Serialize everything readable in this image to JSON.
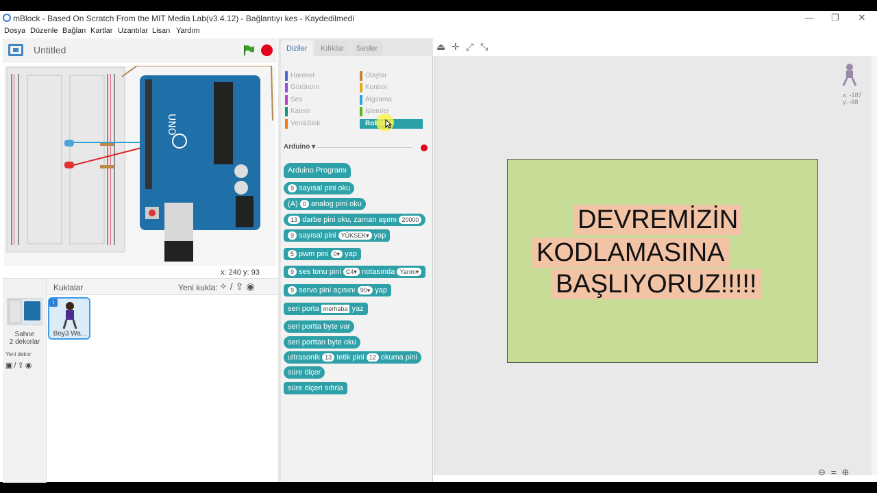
{
  "window": {
    "title": "mBlock - Based On Scratch From the MIT Media Lab(v3.4.12) - Bağlantıyı kes - Kaydedilmedi",
    "min": "—",
    "max": "❐",
    "close": "✕"
  },
  "menu": [
    "Dosya",
    "Düzenle",
    "Bağlan",
    "Kartlar",
    "Uzantılar",
    "Lisan",
    "Yardım"
  ],
  "stage": {
    "project_title": "Untitled",
    "coords": "x: 240  y: 93",
    "breadboard_cols_top": "a b c d e   f g h i j",
    "board_label": "UNO"
  },
  "sprites": {
    "header": "Kuklalar",
    "new_sprite": "Yeni kukla:",
    "scene_label_1": "Sahne",
    "scene_label_2": "2 dekorlar",
    "new_decor": "Yeni dekor",
    "sprite_name": "Boy3 Wa...",
    "info": "i"
  },
  "palette": {
    "tabs": [
      "Diziler",
      "Kılıklar",
      "Sesler"
    ],
    "categories_left": [
      {
        "label": "Hareket",
        "color": "#4a6cd4"
      },
      {
        "label": "Görünüm",
        "color": "#8a55d7"
      },
      {
        "label": "Ses",
        "color": "#bb42c3"
      },
      {
        "label": "Kalem",
        "color": "#0e9a6c"
      },
      {
        "label": "Veri&Blok",
        "color": "#ee7d16"
      }
    ],
    "categories_right": [
      {
        "label": "Olaylar",
        "color": "#c88330"
      },
      {
        "label": "Kontrol",
        "color": "#e1a91a"
      },
      {
        "label": "Algılama",
        "color": "#2ca5e2"
      },
      {
        "label": "İşlemler",
        "color": "#5cb712"
      },
      {
        "label": "Robotlar",
        "color": "#2aa0a8"
      }
    ],
    "extension": "Arduino ▾",
    "blocks": {
      "b1": "Arduino Programı",
      "b2_pin": "9",
      "b2": "sayısal pini oku",
      "b3_a": "(A)",
      "b3_pin": "0",
      "b3": "analog pini oku",
      "b4_pin": "13",
      "b4": "darbe pini oku, zaman aşımı",
      "b4_val": "20000",
      "b5_pin": "9",
      "b5": "sayısal pini",
      "b5_val": "YÜKSEK▾",
      "b5_end": "yap",
      "b6_pin": "5",
      "b6": "pwm pini",
      "b6_val": "0▾",
      "b6_end": "yap",
      "b7_pin": "9",
      "b7": "ses tonu pini",
      "b7_note": "C4▾",
      "b7_mid": "notasında",
      "b7_val": "Yarım▾",
      "b8_pin": "9",
      "b8": "servo pini açısını",
      "b8_val": "90▾",
      "b8_end": "yap",
      "b9": "seri porta",
      "b9_val": "merhaba",
      "b9_end": "yaz",
      "b10": "seri portta byte var",
      "b11": "seri porttan byte oku",
      "b12": "ultrasonik",
      "b12_pin1": "13",
      "b12_mid": "tetik pini",
      "b12_pin2": "12",
      "b12_end": "okuma pini",
      "b13": "süre ölçer",
      "b14": "süre ölçeri sıfırla"
    }
  },
  "script": {
    "note_lines": [
      "DEVREMİZİN",
      "KODLAMASINA",
      "BAŞLIYORUZ!!!!!"
    ],
    "sprite_xy_1": "x: -187",
    "sprite_xy_2": "y: -68"
  }
}
